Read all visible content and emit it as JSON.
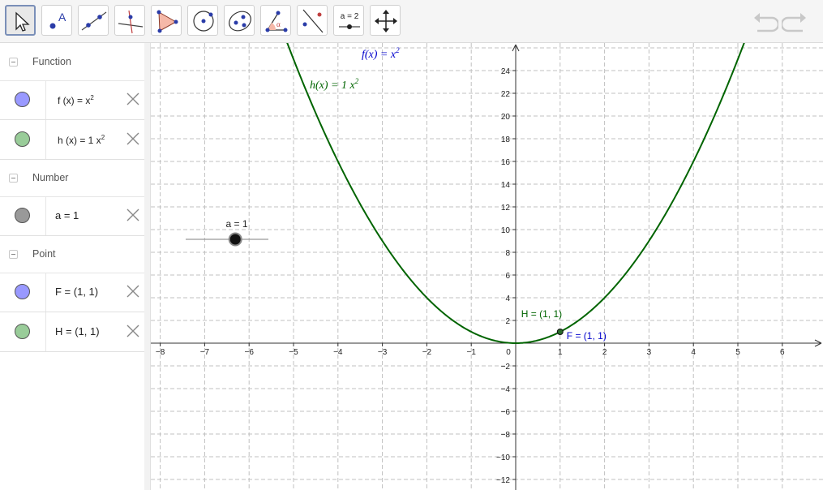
{
  "toolbar": {
    "tools": [
      {
        "name": "move-tool",
        "label": ""
      },
      {
        "name": "point-tool",
        "label": "A"
      },
      {
        "name": "line-tool",
        "label": ""
      },
      {
        "name": "perpendicular-tool",
        "label": ""
      },
      {
        "name": "polygon-tool",
        "label": ""
      },
      {
        "name": "circle-tool",
        "label": ""
      },
      {
        "name": "ellipse-tool",
        "label": ""
      },
      {
        "name": "angle-tool",
        "label": "α"
      },
      {
        "name": "reflect-tool",
        "label": ""
      },
      {
        "name": "slider-tool",
        "label": "a = 2"
      },
      {
        "name": "move-graphics-tool",
        "label": ""
      }
    ],
    "undo_icon": "undo-icon",
    "redo_icon": "redo-icon"
  },
  "algebra": {
    "function_cat": "Function",
    "f_name": "f",
    "f_def": "f (x)  =  x",
    "f_exp": "2",
    "f_color": "#9999ff",
    "h_def": "h (x)  =  1 x",
    "h_exp": "2",
    "h_color": "#99cc99",
    "number_cat": "Number",
    "a_def": "a  =  1",
    "a_color": "#999999",
    "point_cat": "Point",
    "F_def": "F  =  (1, 1)",
    "F_color": "#9999ff",
    "H_def": "H  =  (1, 1)",
    "H_color": "#99cc99"
  },
  "graphics": {
    "f_label": "f(x)  =  x",
    "f_label_exp": "2",
    "h_label": "h(x)  =  1 x",
    "h_label_exp": "2",
    "slider_label": "a = 1",
    "point_F_label": "F = (1, 1)",
    "point_H_label": "H = (1, 1)",
    "f_color": "#0000cc",
    "h_color": "#006400",
    "x_ticks": [
      -8,
      -7,
      -6,
      -5,
      -4,
      -3,
      -2,
      -1,
      0,
      1,
      2,
      3,
      4,
      5,
      6
    ],
    "y_ticks": [
      -12,
      -10,
      -8,
      -6,
      -4,
      -2,
      2,
      4,
      6,
      8,
      10,
      12,
      14,
      16,
      18,
      20,
      22,
      24
    ],
    "slider_value": 1,
    "slider_min": -5,
    "slider_max": 5,
    "point": {
      "x": 1,
      "y": 1
    }
  }
}
